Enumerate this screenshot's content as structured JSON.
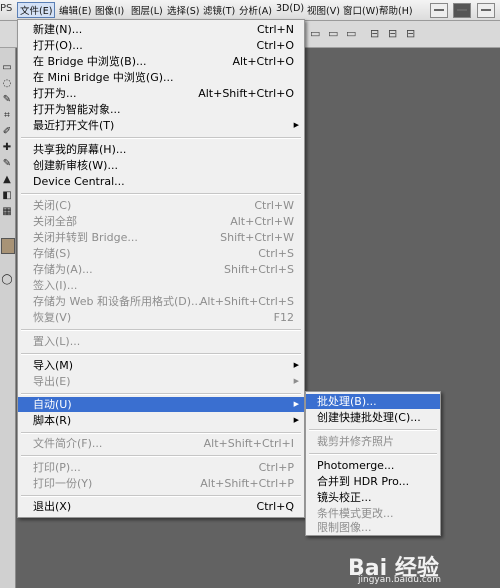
{
  "app": {
    "logo_text": "PS"
  },
  "menubar": [
    {
      "label": "文件(E)",
      "active": true
    },
    {
      "label": "编辑(E)"
    },
    {
      "label": "图像(I)"
    },
    {
      "label": "图层(L)"
    },
    {
      "label": "选择(S)"
    },
    {
      "label": "滤镜(T)"
    },
    {
      "label": "分析(A)"
    },
    {
      "label": "3D(D)"
    },
    {
      "label": "视图(V)"
    },
    {
      "label": "窗口(W)"
    },
    {
      "label": "帮助(H)"
    }
  ],
  "file_menu": {
    "items": [
      {
        "label": "新建(N)...",
        "shortcut": "Ctrl+N"
      },
      {
        "label": "打开(O)...",
        "shortcut": "Ctrl+O"
      },
      {
        "label": "在 Bridge 中浏览(B)...",
        "shortcut": "Alt+Ctrl+O"
      },
      {
        "label": "在 Mini Bridge 中浏览(G)...",
        "shortcut": ""
      },
      {
        "label": "打开为...",
        "shortcut": "Alt+Shift+Ctrl+O"
      },
      {
        "label": "打开为智能对象...",
        "shortcut": ""
      },
      {
        "label": "最近打开文件(T)",
        "shortcut": "",
        "submenu": true
      },
      {
        "label": "共享我的屏幕(H)...",
        "shortcut": ""
      },
      {
        "label": "创建新审核(W)...",
        "shortcut": ""
      },
      {
        "label": "Device Central...",
        "shortcut": ""
      },
      {
        "label": "关闭(C)",
        "shortcut": "Ctrl+W",
        "disabled": true
      },
      {
        "label": "关闭全部",
        "shortcut": "Alt+Ctrl+W",
        "disabled": true
      },
      {
        "label": "关闭并转到 Bridge...",
        "shortcut": "Shift+Ctrl+W",
        "disabled": true
      },
      {
        "label": "存储(S)",
        "shortcut": "Ctrl+S",
        "disabled": true
      },
      {
        "label": "存储为(A)...",
        "shortcut": "Shift+Ctrl+S",
        "disabled": true
      },
      {
        "label": "签入(I)...",
        "shortcut": "",
        "disabled": true
      },
      {
        "label": "存储为 Web 和设备所用格式(D)...",
        "shortcut": "Alt+Shift+Ctrl+S",
        "disabled": true
      },
      {
        "label": "恢复(V)",
        "shortcut": "F12",
        "disabled": true
      },
      {
        "label": "置入(L)...",
        "shortcut": "",
        "disabled": true
      },
      {
        "label": "导入(M)",
        "shortcut": "",
        "submenu": true
      },
      {
        "label": "导出(E)",
        "shortcut": "",
        "submenu": true,
        "disabled": true
      },
      {
        "label": "自动(U)",
        "shortcut": "",
        "submenu": true,
        "highlighted": true
      },
      {
        "label": "脚本(R)",
        "shortcut": "",
        "submenu": true
      },
      {
        "label": "文件简介(F)...",
        "shortcut": "Alt+Shift+Ctrl+I",
        "disabled": true
      },
      {
        "label": "打印(P)...",
        "shortcut": "Ctrl+P",
        "disabled": true
      },
      {
        "label": "打印一份(Y)",
        "shortcut": "Alt+Shift+Ctrl+P",
        "disabled": true
      },
      {
        "label": "退出(X)",
        "shortcut": "Ctrl+Q"
      }
    ]
  },
  "automate_submenu": {
    "items": [
      {
        "label": "批处理(B)...",
        "highlighted": true
      },
      {
        "label": "创建快捷批处理(C)..."
      },
      {
        "label": "裁剪并修齐照片",
        "disabled": true
      },
      {
        "label": "Photomerge..."
      },
      {
        "label": "合并到 HDR Pro..."
      },
      {
        "label": "镜头校正..."
      },
      {
        "label": "条件模式更改...",
        "disabled": true
      },
      {
        "label": "限制图像...",
        "disabled": true
      }
    ]
  },
  "watermark": {
    "logo": "Bai 经验",
    "url": "jingyan.baidu.com"
  },
  "colors": {
    "highlight": "#3a6fd0",
    "disabled_text": "#8d8d8d",
    "menu_bg": "#f0f0f0"
  }
}
